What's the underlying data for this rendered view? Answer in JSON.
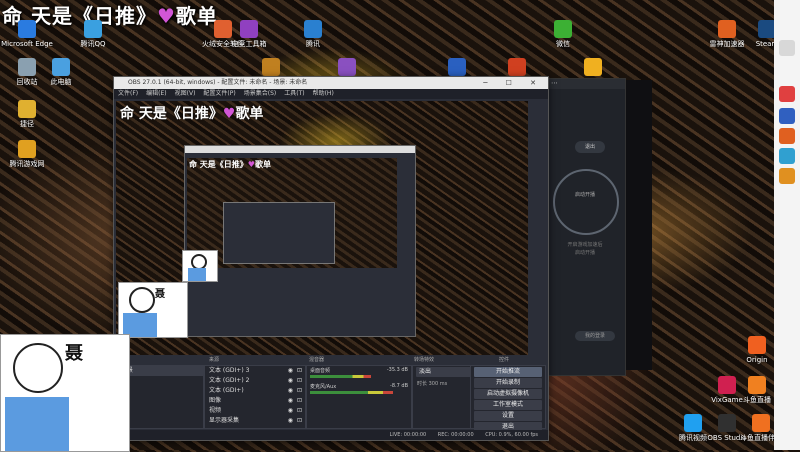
{
  "desktop": {
    "title_banner_left": "命 天是《日推》",
    "title_banner_heart": "♥",
    "title_banner_right": "歌单",
    "icons": [
      {
        "label": "Microsoft Edge",
        "color": "#2a7be0"
      },
      {
        "label": "回收站",
        "color": "#8aa0b0"
      },
      {
        "label": "此电脑",
        "color": "#4aa0e0"
      },
      {
        "label": "捷径",
        "color": "#e0b030"
      },
      {
        "label": "腾讯游戏网",
        "color": "#e0a020"
      },
      {
        "label": "腾讯QQ",
        "color": "#3aa0e0"
      },
      {
        "label": "火绒安全软件",
        "color": "#e06030"
      },
      {
        "label": "电竞工具箱",
        "color": "#9040c0"
      },
      {
        "label": "Steam",
        "color": "#1a4a80"
      },
      {
        "label": "雷神加速器",
        "color": "#e06020"
      },
      {
        "label": "腾讯",
        "color": "#2a80d0"
      },
      {
        "label": "Origin",
        "color": "#f06020"
      },
      {
        "label": "VixGame",
        "color": "#d02050"
      },
      {
        "label": "斗鱼直播",
        "color": "#f08020"
      },
      {
        "label": "腾讯视频",
        "color": "#20a0f0"
      },
      {
        "label": "OBS Studio",
        "color": "#303030"
      },
      {
        "label": "斗鱼直播伴侣",
        "color": "#f07020"
      },
      {
        "label": "Rockstar Games...",
        "color": "#f0b020"
      },
      {
        "label": "微信",
        "color": "#3cb034"
      },
      {
        "label": "三星",
        "color": "#2a60c0"
      },
      {
        "label": "战地战火",
        "color": "#d04020"
      },
      {
        "label": "ASCII",
        "color": "#c08020"
      },
      {
        "label": "GOGO",
        "color": "#8a50c0"
      }
    ]
  },
  "obs": {
    "title": "OBS 27.0.1 (64-bit, windows) - 配置文件: 未命名 - 场景: 未命名",
    "menu": [
      "文件(F)",
      "编辑(E)",
      "视图(V)",
      "配置文件(P)",
      "场景集合(S)",
      "工具(T)",
      "帮助(H)"
    ],
    "window_buttons": "─ ☐ ✕",
    "docks": {
      "scenes_header": "场景",
      "sources_header": "来源",
      "mixer_header": "混音器",
      "transitions_header": "转场特效",
      "controls_header": "控件"
    },
    "scene_item": "场景",
    "sources": [
      "文本 (GDI+) 3",
      "文本 (GDI+) 2",
      "文本 (GDI+)",
      "图像",
      "视频",
      "显示器采集"
    ],
    "mixer": [
      {
        "name": "桌面音频",
        "level": "-35.3 dB",
        "fill": 0.62
      },
      {
        "name": "麦克风/Aux",
        "level": "-8.7 dB",
        "fill": 0.85
      }
    ],
    "transition": {
      "value": "淡出",
      "duration_label": "时长",
      "duration": "300 ms"
    },
    "controls": [
      "开始推流",
      "开始录制",
      "启动虚拟摄像机",
      "工作室模式",
      "设置",
      "退出"
    ],
    "status": {
      "live": "LIVE: 00:00:00",
      "rec": "REC: 00:00:00",
      "cpu": "CPU: 0.9%, 60.00 fps"
    }
  },
  "launcher": {
    "top_button": "退出",
    "main_button": "启动开播",
    "hint_line1": "开启游戏加速后",
    "hint_line2": "启动开播",
    "login": "我的登录"
  },
  "webcam": {
    "label": "聂"
  }
}
